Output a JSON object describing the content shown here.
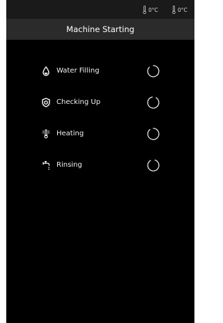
{
  "status_bar": {
    "temperatures": [
      {
        "value": "0°C",
        "icon": "thermometer-icon"
      },
      {
        "value": "0°C",
        "icon": "thermometer-icon"
      }
    ]
  },
  "header": {
    "title": "Machine Starting"
  },
  "steps": [
    {
      "label": "Water Filling",
      "icon": "water-drop-icon",
      "state": "in-progress"
    },
    {
      "label": "Checking Up",
      "icon": "shield-check-icon",
      "state": "in-progress"
    },
    {
      "label": "Heating",
      "icon": "heating-icon",
      "state": "in-progress"
    },
    {
      "label": "Rinsing",
      "icon": "rinse-tap-icon",
      "state": "in-progress"
    }
  ],
  "colors": {
    "background": "#000000",
    "title_bar": "#2b2b2b",
    "status_bar": "#1a1a1a",
    "text": "#ffffff"
  }
}
